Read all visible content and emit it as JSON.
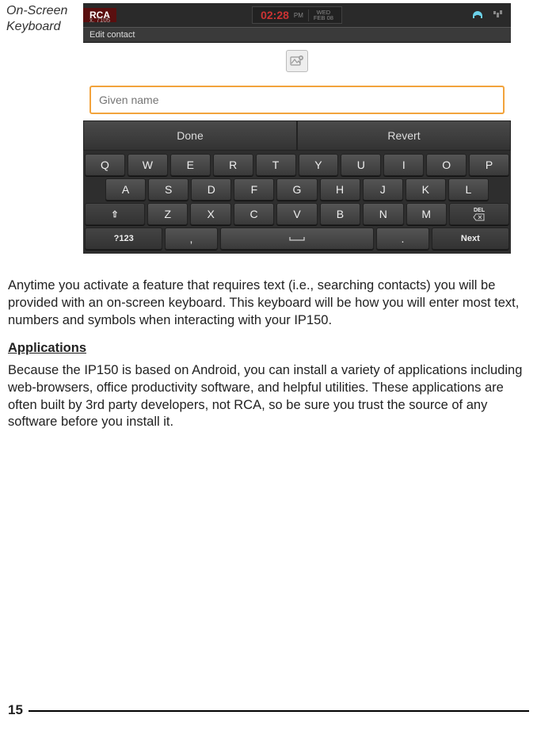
{
  "section_label": "On-Screen Keyboard",
  "screenshot": {
    "brand": "RCA",
    "brand_sub": "x. 7105",
    "clock_time": "02:28",
    "clock_ampm": "PM",
    "clock_day": "WED",
    "clock_date": "FEB 08",
    "context_bar": "Edit contact",
    "input_placeholder": "Given name",
    "action_done": "Done",
    "action_revert": "Revert",
    "kbd_row1": [
      "Q",
      "W",
      "E",
      "R",
      "T",
      "Y",
      "U",
      "I",
      "O",
      "P"
    ],
    "kbd_row2": [
      "A",
      "S",
      "D",
      "F",
      "G",
      "H",
      "J",
      "K",
      "L"
    ],
    "kbd_row3_shift": "⇧",
    "kbd_row3": [
      "Z",
      "X",
      "C",
      "V",
      "B",
      "N",
      "M"
    ],
    "kbd_row3_del": "DEL",
    "kbd_row4_sym": "?123",
    "kbd_row4_comma": ",",
    "kbd_row4_space": " ",
    "kbd_row4_period": ".",
    "kbd_row4_next": "Next"
  },
  "paragraph1": "Anytime you activate a feature that requires text (i.e., searching contacts) you will be provided with an on-screen keyboard.  This keyboard will be how you will enter most text, numbers and symbols when interacting with your IP150.",
  "heading_apps": "Applications",
  "paragraph2": "Because the IP150 is based on Android, you can install a variety of applications including web-browsers, office productivity software, and helpful utilities. These applications are often built by 3rd party developers, not RCA, so be sure you trust the source of any software before you install it.",
  "page_number": "15"
}
